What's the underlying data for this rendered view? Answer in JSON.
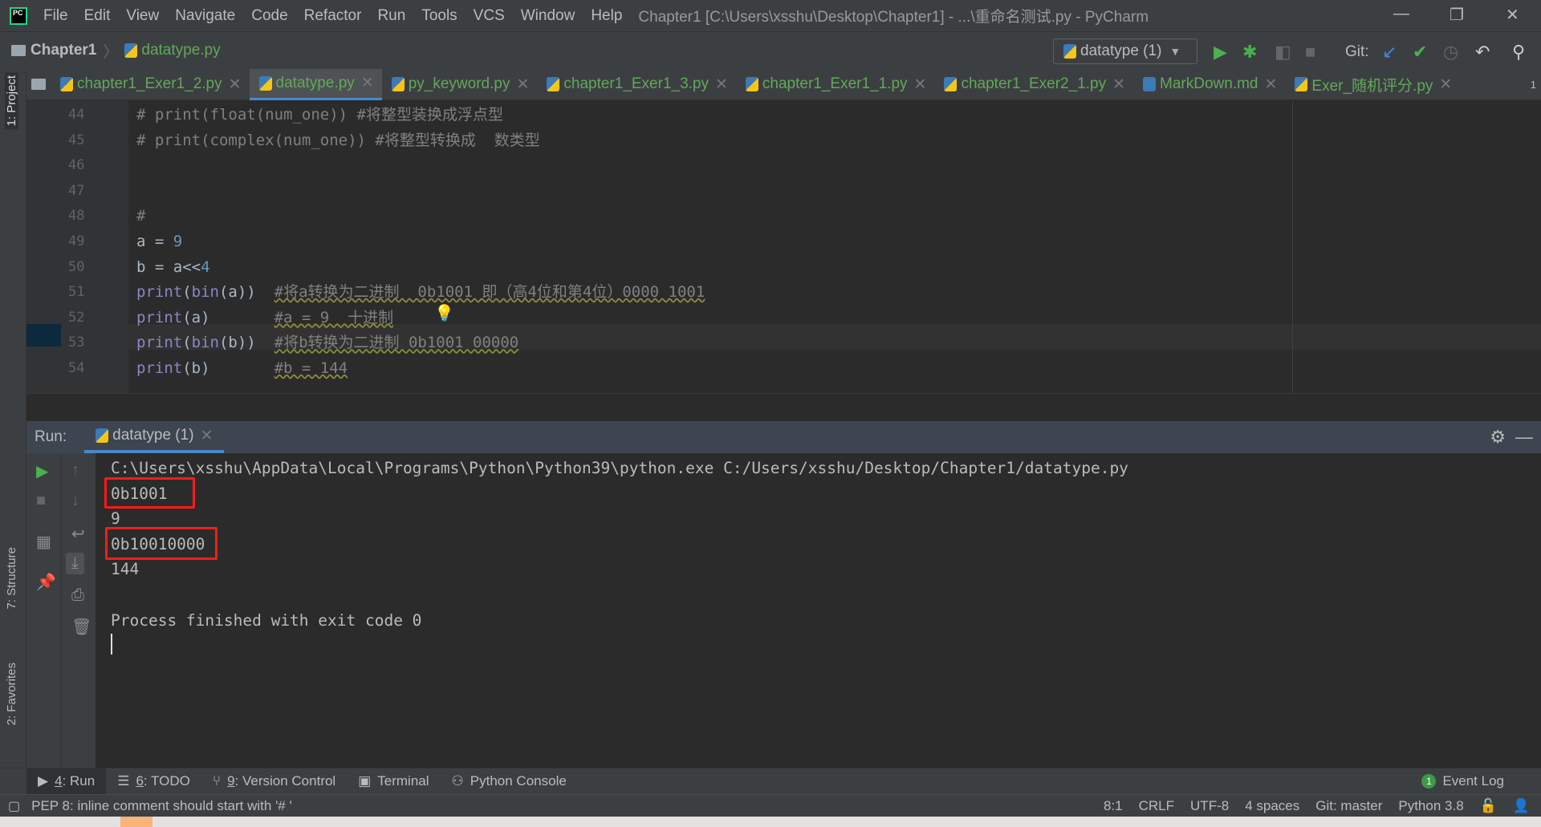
{
  "window": {
    "title": "Chapter1 [C:\\Users\\xsshu\\Desktop\\Chapter1] - ...\\重命名测试.py - PyCharm",
    "app_icon": "PC"
  },
  "menu": [
    "File",
    "Edit",
    "View",
    "Navigate",
    "Code",
    "Refactor",
    "Run",
    "Tools",
    "VCS",
    "Window",
    "Help"
  ],
  "breadcrumb": {
    "project": "Chapter1",
    "file": "datatype.py"
  },
  "toolbar": {
    "run_config": "datatype (1)",
    "git_label": "Git:"
  },
  "tabs": [
    {
      "label": "chapter1_Exer1_2.py",
      "icon": "python-file"
    },
    {
      "label": "datatype.py",
      "icon": "python-file",
      "active": true
    },
    {
      "label": "py_keyword.py",
      "icon": "python-file"
    },
    {
      "label": "chapter1_Exer1_3.py",
      "icon": "python-file"
    },
    {
      "label": "chapter1_Exer1_1.py",
      "icon": "python-file"
    },
    {
      "label": "chapter1_Exer2_1.py",
      "icon": "python-file"
    },
    {
      "label": "MarkDown.md",
      "icon": "markdown-file"
    },
    {
      "label": "Exer_随机评分.py",
      "icon": "python-file"
    }
  ],
  "tabs_overflow": "1",
  "left_panels": {
    "project": "1: Project",
    "structure": "7: Structure",
    "favorites": "2: Favorites"
  },
  "editor": {
    "lines": [
      {
        "n": "44",
        "parts": [
          {
            "t": "# print(float(num_one)) #将整型装换成浮点型",
            "c": "cmt"
          }
        ]
      },
      {
        "n": "45",
        "parts": [
          {
            "t": "# print(complex(num_one)) #将整型转换成  数类型",
            "c": "cmt"
          }
        ]
      },
      {
        "n": "46",
        "parts": []
      },
      {
        "n": "47",
        "parts": []
      },
      {
        "n": "48",
        "parts": [
          {
            "t": "#",
            "c": "cmt"
          }
        ]
      },
      {
        "n": "49",
        "parts": [
          {
            "t": "a = ",
            "c": "var"
          },
          {
            "t": "9",
            "c": "num"
          }
        ]
      },
      {
        "n": "50",
        "parts": [
          {
            "t": "b = a<<",
            "c": "var"
          },
          {
            "t": "4",
            "c": "num"
          }
        ]
      },
      {
        "n": "51",
        "parts": [
          {
            "t": "print",
            "c": "fn"
          },
          {
            "t": "(",
            "c": "var"
          },
          {
            "t": "bin",
            "c": "fn"
          },
          {
            "t": "(a))  ",
            "c": "var"
          },
          {
            "t": "#将a转换为二进制  0b1001 即（高4位和第4位）0000 1001",
            "c": "cmtu"
          }
        ]
      },
      {
        "n": "52",
        "parts": [
          {
            "t": "print",
            "c": "fn"
          },
          {
            "t": "(a)       ",
            "c": "var"
          },
          {
            "t": "#a = 9  十进制",
            "c": "cmtu"
          }
        ]
      },
      {
        "n": "53",
        "parts": [
          {
            "t": "print",
            "c": "fn"
          },
          {
            "t": "(",
            "c": "var"
          },
          {
            "t": "bin",
            "c": "fn"
          },
          {
            "t": "(b))  ",
            "c": "var"
          },
          {
            "t": "#将b转换为二进制 0b1001 00000",
            "c": "cmtu"
          }
        ]
      },
      {
        "n": "54",
        "parts": [
          {
            "t": "print",
            "c": "fn"
          },
          {
            "t": "(b)       ",
            "c": "var"
          },
          {
            "t": "#b = 144",
            "c": "cmtu"
          }
        ]
      }
    ]
  },
  "run": {
    "label": "Run:",
    "tab": "datatype (1)",
    "output": [
      "C:\\Users\\xsshu\\AppData\\Local\\Programs\\Python\\Python39\\python.exe C:/Users/xsshu/Desktop/Chapter1/datatype.py",
      "0b1001",
      "9",
      "0b10010000",
      "144",
      "",
      "Process finished with exit code 0"
    ]
  },
  "bottom_tabs": [
    {
      "key": "4",
      "rest": ": Run",
      "icon": "run-icon"
    },
    {
      "key": "6",
      "rest": ": TODO",
      "icon": "todo-icon"
    },
    {
      "key": "9",
      "rest": ": Version Control",
      "icon": "vcs-icon"
    },
    {
      "key": "",
      "rest": "Terminal",
      "icon": "terminal-icon"
    },
    {
      "key": "",
      "rest": "Python Console",
      "icon": "python-console-icon"
    }
  ],
  "event_log": {
    "count": "1",
    "label": "Event Log"
  },
  "status": {
    "message": "PEP 8: inline comment should start with '# '",
    "position": "8:1",
    "line_sep": "CRLF",
    "encoding": "UTF-8",
    "indent": "4 spaces",
    "git": "Git: master",
    "interpreter": "Python 3.8"
  },
  "colors": {
    "accent": "#4a88c7",
    "highlight_box": "#ff1a1a",
    "file_green": "#62a85a"
  }
}
